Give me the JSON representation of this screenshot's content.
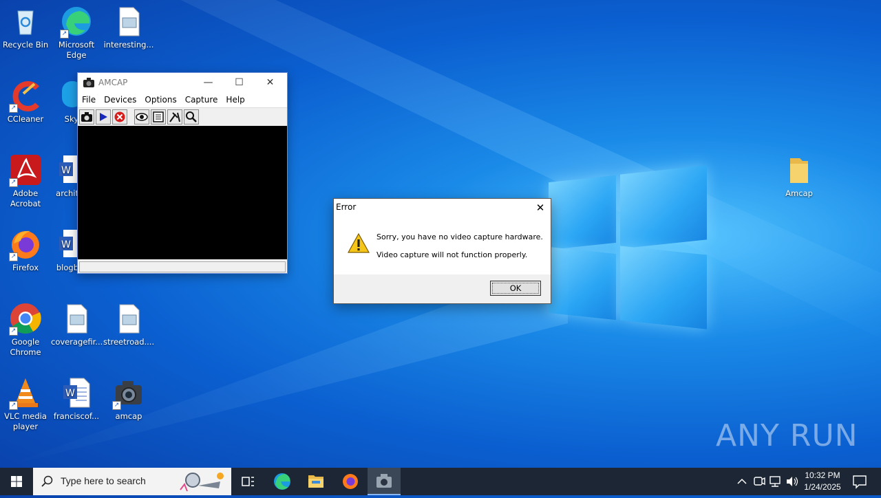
{
  "desktop": {
    "icons": [
      {
        "label": "Recycle Bin",
        "icon": "recycle-bin-icon"
      },
      {
        "label": "Microsoft Edge",
        "icon": "edge-icon"
      },
      {
        "label": "interesting...",
        "icon": "image-file-icon"
      },
      {
        "label": "CCleaner",
        "icon": "ccleaner-icon"
      },
      {
        "label": "Sky",
        "icon": "skype-icon"
      },
      {
        "label": "Adobe Acrobat",
        "icon": "acrobat-icon"
      },
      {
        "label": "archit",
        "icon": "word-doc-icon"
      },
      {
        "label": "Firefox",
        "icon": "firefox-icon"
      },
      {
        "label": "blogb",
        "icon": "word-doc-icon"
      },
      {
        "label": "Google Chrome",
        "icon": "chrome-icon"
      },
      {
        "label": "coveragefir...",
        "icon": "image-file-icon"
      },
      {
        "label": "streetroad....",
        "icon": "image-file-icon"
      },
      {
        "label": "VLC media player",
        "icon": "vlc-icon"
      },
      {
        "label": "franciscof...",
        "icon": "word-doc-icon"
      },
      {
        "label": "amcap",
        "icon": "camera-icon"
      },
      {
        "label": "Amcap",
        "icon": "folder-icon"
      }
    ]
  },
  "amcap": {
    "title": "AMCAP",
    "menu": [
      "File",
      "Devices",
      "Options",
      "Capture",
      "Help"
    ],
    "toolbar": [
      "camera-icon",
      "play-icon",
      "stop-icon",
      "preview-eye-icon",
      "settings-icon",
      "tools-icon",
      "zoom-icon"
    ]
  },
  "error_dialog": {
    "title": "Error",
    "line1": "Sorry, you have no video capture hardware.",
    "line2": "Video capture will not function properly.",
    "ok_label": "OK"
  },
  "watermark": {
    "text": "ANY RUN"
  },
  "taskbar": {
    "search_placeholder": "Type here to search",
    "time": "10:32 PM",
    "date": "1/24/2025"
  },
  "colors": {
    "taskbar_bg": "#1c2634",
    "desktop_accent": "#0b5fd0"
  }
}
